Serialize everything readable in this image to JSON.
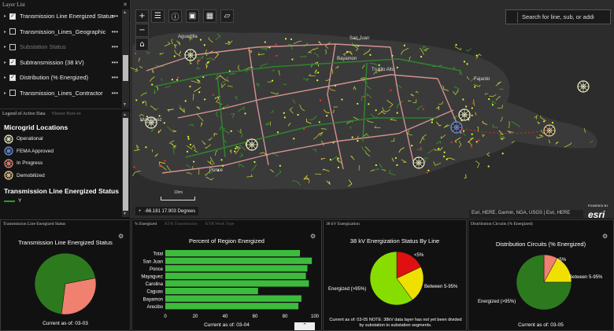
{
  "layer_list": {
    "title": "Layer List",
    "close": "✕",
    "items": [
      {
        "label": "Transmission Line Energized Status",
        "checked": true,
        "dim": false
      },
      {
        "label": "Transmission_Lines_Geographic",
        "checked": false,
        "dim": false
      },
      {
        "label": "Substation Status",
        "checked": false,
        "dim": true
      },
      {
        "label": "Subtransmission (38 kV)",
        "checked": true,
        "dim": false
      },
      {
        "label": "Distribution (% Energized)",
        "checked": true,
        "dim": false
      },
      {
        "label": "Transmission_Lines_Contractor",
        "checked": false,
        "dim": false
      }
    ],
    "more": "•••"
  },
  "legend": {
    "tab1": "Legend of Active Data",
    "tab2": "Viewer How-to",
    "title": "Microgrid Locations",
    "items": [
      {
        "label": "Operational",
        "color": "#e8e8c0"
      },
      {
        "label": "FEMA Approved",
        "color": "#6f8fd8"
      },
      {
        "label": "In Progress",
        "color": "#e88a80"
      },
      {
        "label": "Demobilized",
        "color": "#e8c890"
      }
    ],
    "section2": "Transmission Line Energized Status",
    "line_label": "Y"
  },
  "map": {
    "search_placeholder": "Search for line, sub, or addi",
    "coords": "-66.181 17.903 Degrees",
    "coord_plus": "+",
    "scale_label": "10mi",
    "attribution": "Esri, HERE, Garmin, NGA, USGS | Esri, HERE",
    "powered_by": "POWERED BY",
    "esri_logo": "esri",
    "places": [
      {
        "name": "Aguadilla"
      },
      {
        "name": "San Juan"
      },
      {
        "name": "Bayamon"
      },
      {
        "name": "Trujillo Alto"
      },
      {
        "name": "Fajardo"
      },
      {
        "name": "Mayaguez"
      },
      {
        "name": "Ponce"
      }
    ]
  },
  "panels": {
    "transmission": {
      "tab": "Transmission Line Energized Status",
      "title": "Transmission Line Energized Status",
      "footer": "Current as of: 03-03"
    },
    "region": {
      "tabs": [
        "% Energized",
        "KTR Transmission",
        "KTR Work Type"
      ],
      "title": "Percent of Region Energized",
      "footer": "Current as of: 03-04",
      "up": "⌃"
    },
    "kv38": {
      "tab": "38 kV Energization",
      "title": "38 kV Energization Status By Line",
      "lbl_lt5": "<5%",
      "lbl_mid": "Between 5-95%",
      "lbl_gt95": "Energized (>95%)",
      "note": "Current as of: 03-05  NOTE: 38kV data layer has not yet been divided by substation to substation segments."
    },
    "dist": {
      "tab": "Distribution Circuits (% Energized)",
      "title": "Distribution Circuits (% Energized)",
      "lbl_lt5": "<5%",
      "lbl_mid": "Between 5-95%",
      "lbl_gt95": "Energized (>95%)",
      "footer": "Current as of: 03-05"
    }
  },
  "chart_data": [
    {
      "type": "pie",
      "title": "Transmission Line Energized Status",
      "slices": [
        {
          "label": "",
          "value": 70,
          "color": "#2d7a1e"
        },
        {
          "label": "",
          "value": 30,
          "color": "#f08070"
        }
      ]
    },
    {
      "type": "bar",
      "orientation": "horizontal",
      "title": "Percent of Region Energized",
      "categories": [
        "Total",
        "San Juan",
        "Ponce",
        "Mayaguez",
        "Carolina",
        "Caguas",
        "Bayamon",
        "Arecibo"
      ],
      "values": [
        90,
        98,
        95,
        94,
        96,
        62,
        91,
        89
      ],
      "xlim": [
        0,
        100
      ],
      "xticks": [
        0,
        20,
        40,
        60,
        80,
        100
      ],
      "color": "#3dbb3d"
    },
    {
      "type": "pie",
      "title": "38 kV Energization Status By Line",
      "slices": [
        {
          "label": "<5%",
          "value": 18,
          "color": "#e01010"
        },
        {
          "label": "Between 5-95%",
          "value": 22,
          "color": "#f0e000"
        },
        {
          "label": "Energized (>95%)",
          "value": 60,
          "color": "#88dd00"
        }
      ]
    },
    {
      "type": "pie",
      "title": "Distribution Circuits (% Energized)",
      "slices": [
        {
          "label": "<5%",
          "value": 8,
          "color": "#f08070"
        },
        {
          "label": "Between 5-95%",
          "value": 17,
          "color": "#f0e000"
        },
        {
          "label": "Energized (>95%)",
          "value": 75,
          "color": "#2d7a1e"
        }
      ]
    }
  ]
}
